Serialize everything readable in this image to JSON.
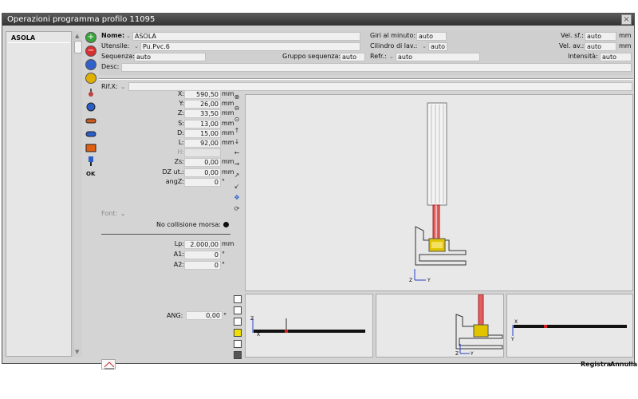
{
  "window": {
    "title": "Operazioni programma  profilo 11095",
    "close_glyph": "×"
  },
  "list": {
    "items": [
      "ASOLA"
    ]
  },
  "toolbar": {
    "ok_label": "OK"
  },
  "form": {
    "nome_label": "Nome:",
    "nome_value": "ASOLA",
    "utensile_label": "Utensile:",
    "utensile_value": "Pu.Pvc.6",
    "sequenza_label": "Sequenza:",
    "sequenza_value": "auto",
    "gruppo_label": "Gruppo sequenza:",
    "gruppo_value": "auto",
    "desc_label": "Desc:",
    "desc_value": "",
    "giri_label": "Giri al minuto:",
    "giri_value": "auto",
    "cilindro_label": "Cilindro di lav.:",
    "cilindro_value": "auto",
    "refr_label": "Refr.:",
    "refr_value": "auto",
    "velsf_label": "Vel. sf.:",
    "velsf_value": "auto",
    "velsf_unit": "mm",
    "velav_label": "Vel. av.:",
    "velav_value": "auto",
    "velav_unit": "mm",
    "intensita_label": "Intensità:",
    "intensita_value": "auto"
  },
  "rif": {
    "label": "Rif.X:",
    "value": ""
  },
  "params": [
    {
      "label": "X:",
      "value": "590,50",
      "unit": "mm"
    },
    {
      "label": "Y:",
      "value": "26,00",
      "unit": "mm"
    },
    {
      "label": "Z:",
      "value": "33,50",
      "unit": "mm"
    },
    {
      "label": "S:",
      "value": "13,00",
      "unit": "mm"
    },
    {
      "label": "D:",
      "value": "15,00",
      "unit": "mm"
    },
    {
      "label": "L:",
      "value": "92,00",
      "unit": "mm"
    },
    {
      "label": "H:",
      "value": "",
      "unit": ""
    },
    {
      "label": "Zs:",
      "value": "0,00",
      "unit": "mm"
    },
    {
      "label": "DZ ut.:",
      "value": "0,00",
      "unit": "mm"
    },
    {
      "label": "angZ:",
      "value": "0",
      "unit": "°"
    }
  ],
  "font": {
    "label": "Font:"
  },
  "collision": {
    "label": "No collisione morsa:"
  },
  "lower_params": [
    {
      "label": "Lp:",
      "value": "2.000,00",
      "unit": "mm"
    },
    {
      "label": "A1:",
      "value": "0",
      "unit": "°"
    },
    {
      "label": "A2:",
      "value": "0",
      "unit": "°"
    }
  ],
  "ang": {
    "label": "ANG:",
    "value": "0,00",
    "unit": "°"
  },
  "viewer": {
    "axis_x": "X",
    "axis_y": "Y",
    "axis_z": "Z"
  },
  "buttons": {
    "registra": "Registra",
    "annulla": "Annulla"
  },
  "colors": {
    "titlebar": "#3a3a3a",
    "tool_red": "#cc3333",
    "tool_yellow": "#d8c800"
  }
}
